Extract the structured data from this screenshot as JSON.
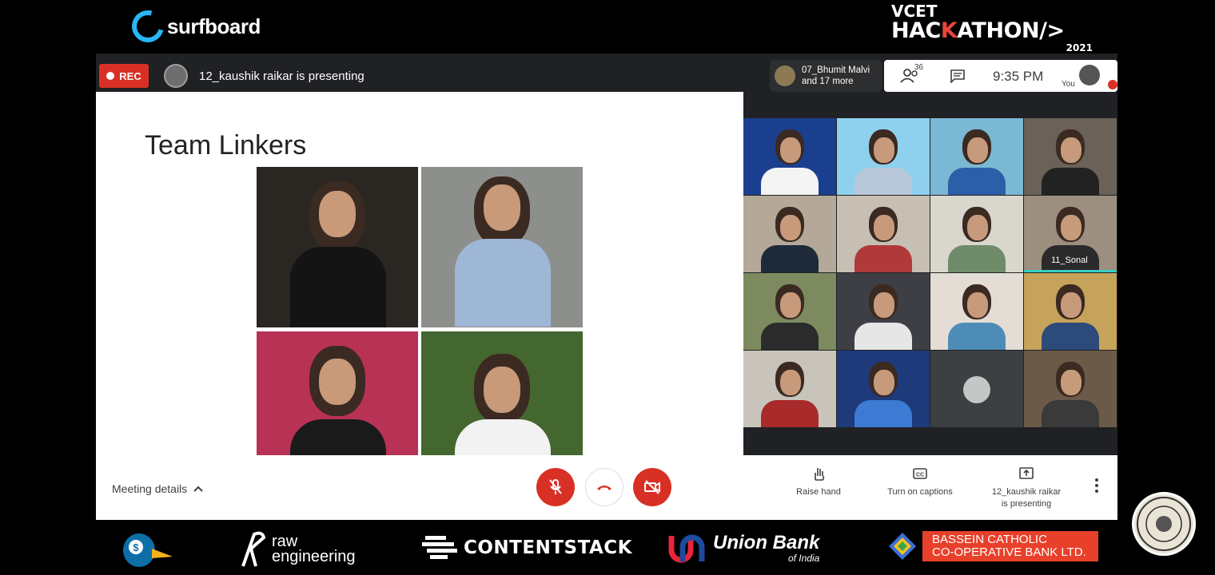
{
  "brand": {
    "surfboard": "surfboard",
    "hackathon_line1": "VCET",
    "hackathon_line2a": "HAC",
    "hackathon_line2b": "K",
    "hackathon_line2c": "ATHON/>",
    "hackathon_year": "2021"
  },
  "topbar": {
    "rec": "REC",
    "presenting": "12_kaushik raikar is presenting",
    "participants_line1": "07_Bhumit Malvi",
    "participants_line2": "and 17 more",
    "people_count": "36",
    "time": "9:35 PM",
    "you": "You"
  },
  "slide": {
    "title": "Team Linkers"
  },
  "tiles": [
    {
      "name": ""
    },
    {
      "name": ""
    },
    {
      "name": ""
    },
    {
      "name": ""
    },
    {
      "name": ""
    },
    {
      "name": ""
    },
    {
      "name": ""
    },
    {
      "name": "11_Sonal"
    },
    {
      "name": ""
    },
    {
      "name": ""
    },
    {
      "name": ""
    },
    {
      "name": ""
    },
    {
      "name": ""
    },
    {
      "name": ""
    },
    {
      "name": ""
    },
    {
      "name": ""
    }
  ],
  "bottombar": {
    "meeting_details": "Meeting details",
    "raise_hand": "Raise hand",
    "captions": "Turn on captions",
    "presenting_line1": "12_kaushik raikar",
    "presenting_line2": "is presenting"
  },
  "sponsors": {
    "raw_line1": "raw",
    "raw_line2": "engineering",
    "contentstack": "CONTENTSTACK",
    "union_line1": "Union Bank",
    "union_line2": "of India",
    "bassein_line1": "BASSEIN CATHOLIC",
    "bassein_line2": "CO-OPERATIVE BANK LTD."
  },
  "colors": {
    "rec_red": "#d93025",
    "accent_blue": "#29b6f6",
    "hackathon_accent": "#e8463a"
  }
}
